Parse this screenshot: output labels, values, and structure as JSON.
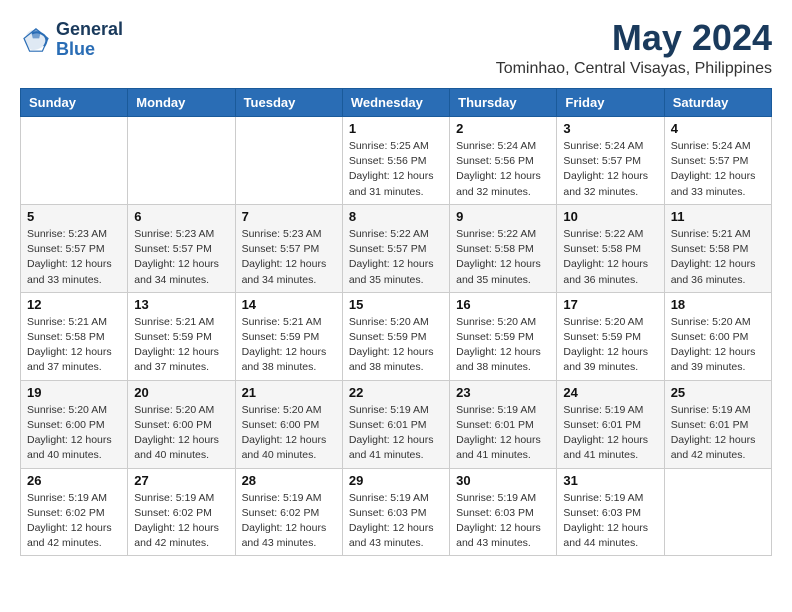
{
  "header": {
    "logo_line1": "General",
    "logo_line2": "Blue",
    "month": "May 2024",
    "location": "Tominhao, Central Visayas, Philippines"
  },
  "weekdays": [
    "Sunday",
    "Monday",
    "Tuesday",
    "Wednesday",
    "Thursday",
    "Friday",
    "Saturday"
  ],
  "weeks": [
    [
      {
        "day": "",
        "info": ""
      },
      {
        "day": "",
        "info": ""
      },
      {
        "day": "",
        "info": ""
      },
      {
        "day": "1",
        "info": "Sunrise: 5:25 AM\nSunset: 5:56 PM\nDaylight: 12 hours\nand 31 minutes."
      },
      {
        "day": "2",
        "info": "Sunrise: 5:24 AM\nSunset: 5:56 PM\nDaylight: 12 hours\nand 32 minutes."
      },
      {
        "day": "3",
        "info": "Sunrise: 5:24 AM\nSunset: 5:57 PM\nDaylight: 12 hours\nand 32 minutes."
      },
      {
        "day": "4",
        "info": "Sunrise: 5:24 AM\nSunset: 5:57 PM\nDaylight: 12 hours\nand 33 minutes."
      }
    ],
    [
      {
        "day": "5",
        "info": "Sunrise: 5:23 AM\nSunset: 5:57 PM\nDaylight: 12 hours\nand 33 minutes."
      },
      {
        "day": "6",
        "info": "Sunrise: 5:23 AM\nSunset: 5:57 PM\nDaylight: 12 hours\nand 34 minutes."
      },
      {
        "day": "7",
        "info": "Sunrise: 5:23 AM\nSunset: 5:57 PM\nDaylight: 12 hours\nand 34 minutes."
      },
      {
        "day": "8",
        "info": "Sunrise: 5:22 AM\nSunset: 5:57 PM\nDaylight: 12 hours\nand 35 minutes."
      },
      {
        "day": "9",
        "info": "Sunrise: 5:22 AM\nSunset: 5:58 PM\nDaylight: 12 hours\nand 35 minutes."
      },
      {
        "day": "10",
        "info": "Sunrise: 5:22 AM\nSunset: 5:58 PM\nDaylight: 12 hours\nand 36 minutes."
      },
      {
        "day": "11",
        "info": "Sunrise: 5:21 AM\nSunset: 5:58 PM\nDaylight: 12 hours\nand 36 minutes."
      }
    ],
    [
      {
        "day": "12",
        "info": "Sunrise: 5:21 AM\nSunset: 5:58 PM\nDaylight: 12 hours\nand 37 minutes."
      },
      {
        "day": "13",
        "info": "Sunrise: 5:21 AM\nSunset: 5:59 PM\nDaylight: 12 hours\nand 37 minutes."
      },
      {
        "day": "14",
        "info": "Sunrise: 5:21 AM\nSunset: 5:59 PM\nDaylight: 12 hours\nand 38 minutes."
      },
      {
        "day": "15",
        "info": "Sunrise: 5:20 AM\nSunset: 5:59 PM\nDaylight: 12 hours\nand 38 minutes."
      },
      {
        "day": "16",
        "info": "Sunrise: 5:20 AM\nSunset: 5:59 PM\nDaylight: 12 hours\nand 38 minutes."
      },
      {
        "day": "17",
        "info": "Sunrise: 5:20 AM\nSunset: 5:59 PM\nDaylight: 12 hours\nand 39 minutes."
      },
      {
        "day": "18",
        "info": "Sunrise: 5:20 AM\nSunset: 6:00 PM\nDaylight: 12 hours\nand 39 minutes."
      }
    ],
    [
      {
        "day": "19",
        "info": "Sunrise: 5:20 AM\nSunset: 6:00 PM\nDaylight: 12 hours\nand 40 minutes."
      },
      {
        "day": "20",
        "info": "Sunrise: 5:20 AM\nSunset: 6:00 PM\nDaylight: 12 hours\nand 40 minutes."
      },
      {
        "day": "21",
        "info": "Sunrise: 5:20 AM\nSunset: 6:00 PM\nDaylight: 12 hours\nand 40 minutes."
      },
      {
        "day": "22",
        "info": "Sunrise: 5:19 AM\nSunset: 6:01 PM\nDaylight: 12 hours\nand 41 minutes."
      },
      {
        "day": "23",
        "info": "Sunrise: 5:19 AM\nSunset: 6:01 PM\nDaylight: 12 hours\nand 41 minutes."
      },
      {
        "day": "24",
        "info": "Sunrise: 5:19 AM\nSunset: 6:01 PM\nDaylight: 12 hours\nand 41 minutes."
      },
      {
        "day": "25",
        "info": "Sunrise: 5:19 AM\nSunset: 6:01 PM\nDaylight: 12 hours\nand 42 minutes."
      }
    ],
    [
      {
        "day": "26",
        "info": "Sunrise: 5:19 AM\nSunset: 6:02 PM\nDaylight: 12 hours\nand 42 minutes."
      },
      {
        "day": "27",
        "info": "Sunrise: 5:19 AM\nSunset: 6:02 PM\nDaylight: 12 hours\nand 42 minutes."
      },
      {
        "day": "28",
        "info": "Sunrise: 5:19 AM\nSunset: 6:02 PM\nDaylight: 12 hours\nand 43 minutes."
      },
      {
        "day": "29",
        "info": "Sunrise: 5:19 AM\nSunset: 6:03 PM\nDaylight: 12 hours\nand 43 minutes."
      },
      {
        "day": "30",
        "info": "Sunrise: 5:19 AM\nSunset: 6:03 PM\nDaylight: 12 hours\nand 43 minutes."
      },
      {
        "day": "31",
        "info": "Sunrise: 5:19 AM\nSunset: 6:03 PM\nDaylight: 12 hours\nand 44 minutes."
      },
      {
        "day": "",
        "info": ""
      }
    ]
  ]
}
